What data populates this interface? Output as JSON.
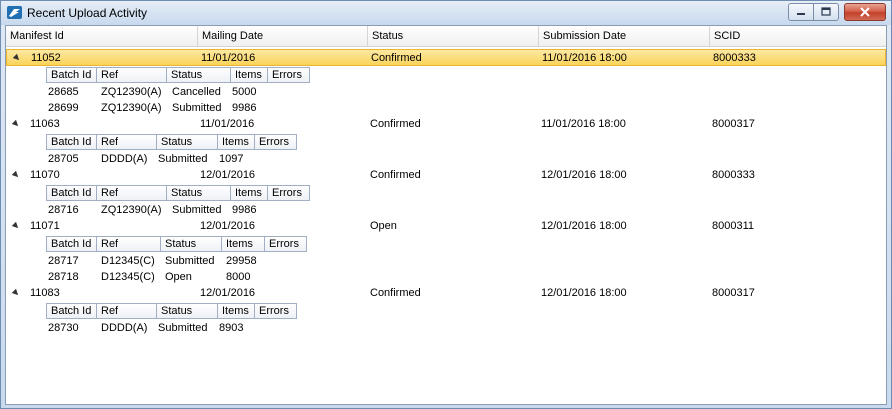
{
  "window": {
    "title": "Recent Upload Activity"
  },
  "columns": {
    "manifest_id": "Manifest Id",
    "mailing_date": "Mailing Date",
    "status": "Status",
    "submission_date": "Submission Date",
    "scid": "SCID"
  },
  "subcolumns": {
    "batch_id": "Batch Id",
    "ref": "Ref",
    "status": "Status",
    "items": "Items",
    "errors": "Errors"
  },
  "manifests": [
    {
      "manifest_id": "11052",
      "mailing_date": "11/01/2016",
      "status": "Confirmed",
      "submission_date": "11/01/2016 18:00",
      "scid": "8000333",
      "batches": [
        {
          "batch_id": "28685",
          "ref": "ZQ12390(A)",
          "status": "Cancelled",
          "items": "5000"
        },
        {
          "batch_id": "28699",
          "ref": "ZQ12390(A)",
          "status": "Submitted",
          "items": "9986"
        }
      ]
    },
    {
      "manifest_id": "11063",
      "mailing_date": "11/01/2016",
      "status": "Confirmed",
      "submission_date": "11/01/2016 18:00",
      "scid": "8000317",
      "batches": [
        {
          "batch_id": "28705",
          "ref": "DDDD(A)",
          "status": "Submitted",
          "items": "1097"
        }
      ]
    },
    {
      "manifest_id": "11070",
      "mailing_date": "12/01/2016",
      "status": "Confirmed",
      "submission_date": "12/01/2016 18:00",
      "scid": "8000333",
      "batches": [
        {
          "batch_id": "28716",
          "ref": "ZQ12390(A)",
          "status": "Submitted",
          "items": "9986"
        }
      ]
    },
    {
      "manifest_id": "11071",
      "mailing_date": "12/01/2016",
      "status": "Open",
      "submission_date": "12/01/2016 18:00",
      "scid": "8000311",
      "batches": [
        {
          "batch_id": "28717",
          "ref": "D12345(C)",
          "status": "Submitted",
          "items": "29958"
        },
        {
          "batch_id": "28718",
          "ref": "D12345(C)",
          "status": "Open",
          "items": "8000"
        }
      ]
    },
    {
      "manifest_id": "11083",
      "mailing_date": "12/01/2016",
      "status": "Confirmed",
      "submission_date": "12/01/2016 18:00",
      "scid": "8000317",
      "batches": [
        {
          "batch_id": "28730",
          "ref": "DDDD(A)",
          "status": "Submitted",
          "items": "8903"
        }
      ]
    }
  ],
  "selected_manifest": "11052"
}
